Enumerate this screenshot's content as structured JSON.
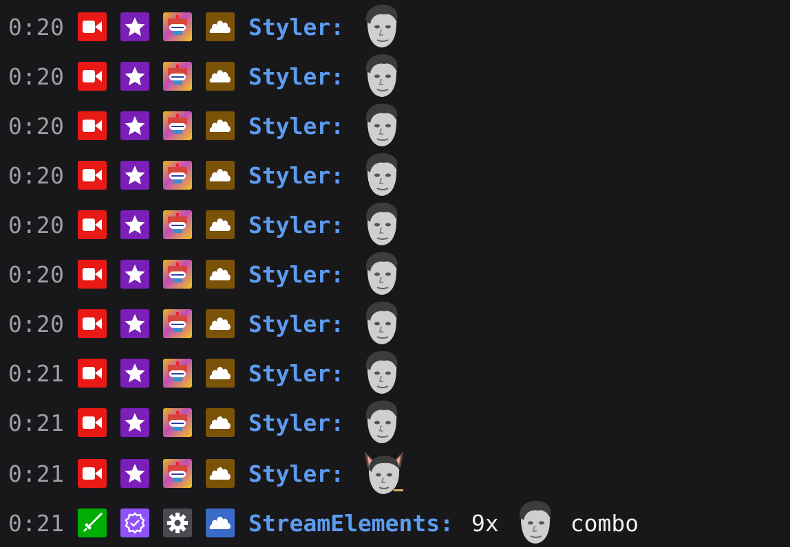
{
  "colors": {
    "background": "#18181b",
    "timestamp": "#9e9ea5",
    "username": "#5c9cf0",
    "message": "#efeff1",
    "broadcaster_badge": "#e91916",
    "star_badge": "#7a1fb8",
    "gold_badge": "#7a5208",
    "moderator_badge": "#00ad03",
    "verified_badge": "#8f52fb",
    "bot_badge": "#4a4a50",
    "blue_cloud_badge": "#3b6bc9"
  },
  "messages": [
    {
      "time": "0:20",
      "badges": [
        "broadcaster-camera-icon",
        "star-icon",
        "multicolor-sub-icon",
        "cloud-icon"
      ],
      "user": "Styler:",
      "emote": "face-emote"
    },
    {
      "time": "0:20",
      "badges": [
        "broadcaster-camera-icon",
        "star-icon",
        "multicolor-sub-icon",
        "cloud-icon"
      ],
      "user": "Styler:",
      "emote": "face-emote"
    },
    {
      "time": "0:20",
      "badges": [
        "broadcaster-camera-icon",
        "star-icon",
        "multicolor-sub-icon",
        "cloud-icon"
      ],
      "user": "Styler:",
      "emote": "face-emote"
    },
    {
      "time": "0:20",
      "badges": [
        "broadcaster-camera-icon",
        "star-icon",
        "multicolor-sub-icon",
        "cloud-icon"
      ],
      "user": "Styler:",
      "emote": "face-emote"
    },
    {
      "time": "0:20",
      "badges": [
        "broadcaster-camera-icon",
        "star-icon",
        "multicolor-sub-icon",
        "cloud-icon"
      ],
      "user": "Styler:",
      "emote": "face-emote"
    },
    {
      "time": "0:20",
      "badges": [
        "broadcaster-camera-icon",
        "star-icon",
        "multicolor-sub-icon",
        "cloud-icon"
      ],
      "user": "Styler:",
      "emote": "face-emote"
    },
    {
      "time": "0:20",
      "badges": [
        "broadcaster-camera-icon",
        "star-icon",
        "multicolor-sub-icon",
        "cloud-icon"
      ],
      "user": "Styler:",
      "emote": "face-emote"
    },
    {
      "time": "0:21",
      "badges": [
        "broadcaster-camera-icon",
        "star-icon",
        "multicolor-sub-icon",
        "cloud-icon"
      ],
      "user": "Styler:",
      "emote": "face-emote"
    },
    {
      "time": "0:21",
      "badges": [
        "broadcaster-camera-icon",
        "star-icon",
        "multicolor-sub-icon",
        "cloud-icon"
      ],
      "user": "Styler:",
      "emote": "face-emote"
    },
    {
      "time": "0:21",
      "badges": [
        "broadcaster-camera-icon",
        "star-icon",
        "multicolor-sub-icon",
        "cloud-icon"
      ],
      "user": "Styler:",
      "emote": "cat-face-emote"
    }
  ],
  "combo_message": {
    "time": "0:21",
    "badges": [
      "moderator-sword-icon",
      "verified-check-icon",
      "gear-icon",
      "blue-cloud-icon"
    ],
    "user": "StreamElements:",
    "count": "9x",
    "emote": "face-emote",
    "word": "combo"
  }
}
